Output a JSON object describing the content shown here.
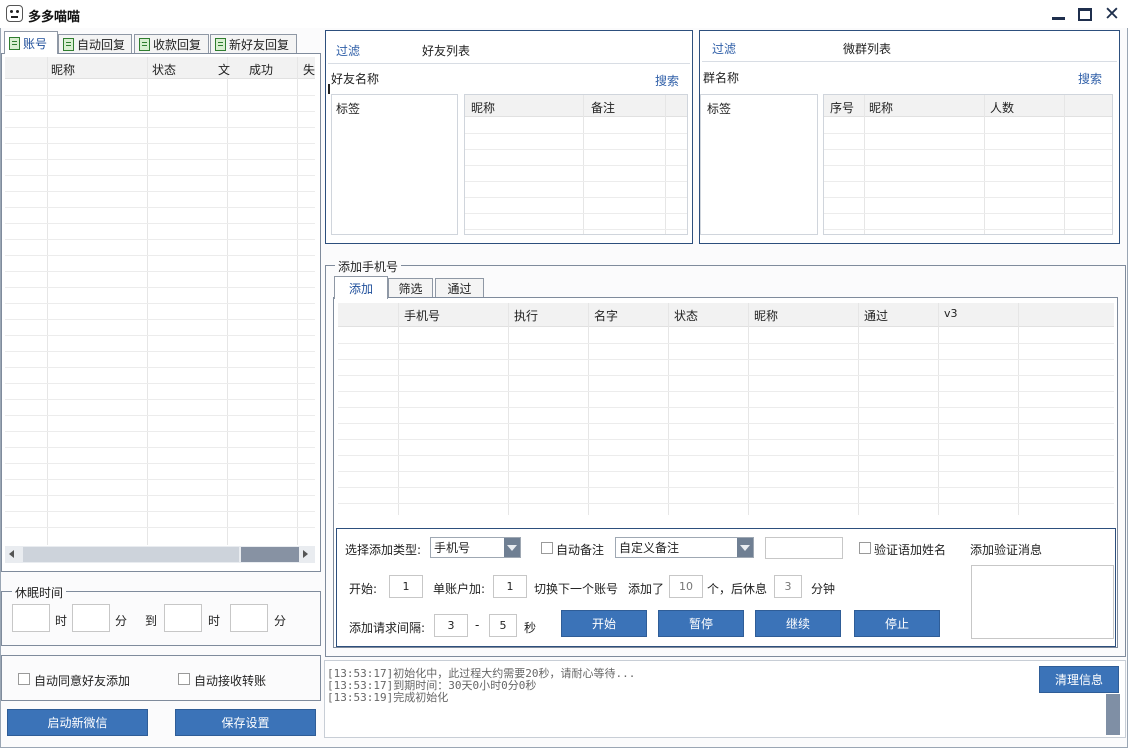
{
  "window": {
    "title": "多多喵喵"
  },
  "left_tabs": [
    "账号",
    "自动回复",
    "收款回复",
    "新好友回复"
  ],
  "account_table": {
    "headers": [
      "昵称",
      "状态",
      "文",
      "成功",
      "失"
    ]
  },
  "sleep": {
    "legend": "休眠时间",
    "hour": "时",
    "minute": "分",
    "to": "到"
  },
  "options": {
    "auto_accept_friend": "自动同意好友添加",
    "auto_receive_transfer": "自动接收转账"
  },
  "buttons": {
    "start_wechat": "启动新微信",
    "save_settings": "保存设置",
    "clear_info": "清理信息"
  },
  "friend_panel": {
    "filter": "过滤",
    "title": "好友列表",
    "name_label": "好友名称",
    "search": "搜索",
    "tag_header": "标签",
    "headers": [
      "昵称",
      "备注"
    ]
  },
  "group_panel": {
    "filter": "过滤",
    "title": "微群列表",
    "name_label": "群名称",
    "search": "搜索",
    "tag_header": "标签",
    "headers": [
      "序号",
      "昵称",
      "人数"
    ]
  },
  "add_phone": {
    "legend": "添加手机号",
    "tabs": [
      "添加",
      "筛选",
      "通过"
    ],
    "headers": [
      "手机号",
      "执行",
      "名字",
      "状态",
      "昵称",
      "通过",
      "v3"
    ],
    "type_label": "选择添加类型:",
    "type_value": "手机号",
    "auto_remark": "自动备注",
    "remark_value": "自定义备注",
    "verify_name": "验证语加姓名",
    "verify_msg": "添加验证消息",
    "start_label": "开始:",
    "start_value": "1",
    "per_account_label": "单账户加:",
    "per_account_value": "1",
    "switch_text": "切换下一个账号",
    "added_text": "添加了",
    "added_value": "10",
    "rest_text": "个，后休息",
    "rest_value": "3",
    "minute_text": "分钟",
    "interval_label": "添加请求间隔:",
    "interval_from": "3",
    "dash": "-",
    "interval_to": "5",
    "sec": "秒",
    "actions": [
      "开始",
      "暂停",
      "继续",
      "停止"
    ]
  },
  "log_lines": [
    "[13:53:17]初始化中，此过程大约需要20秒，请耐心等待...",
    "[13:53:17]到期时间：30天0小时0分0秒",
    "[13:53:19]完成初始化"
  ]
}
